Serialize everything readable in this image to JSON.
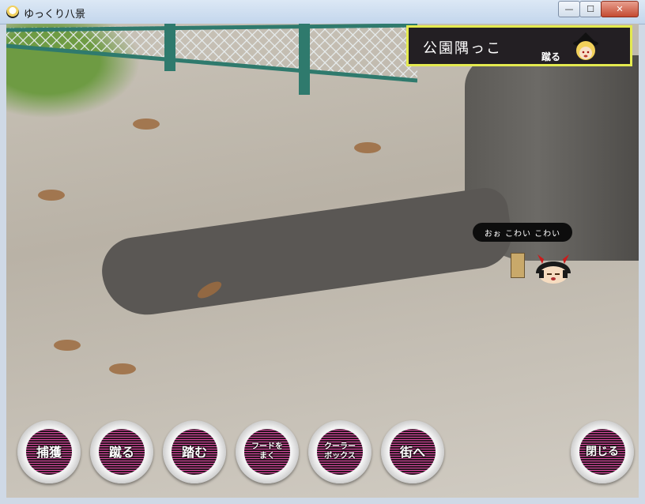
{
  "window": {
    "title": "ゆっくり八景",
    "icon": "yukkuri-app-icon",
    "controls": {
      "minimize": "—",
      "maximize": "☐",
      "close": "✕"
    }
  },
  "location": {
    "name": "公園隅っこ",
    "action": "蹴る",
    "border_color": "#e4ea4f"
  },
  "speech_bubble": {
    "text": "おぉ こわい こわい"
  },
  "actions": [
    {
      "label": "捕獲"
    },
    {
      "label": "蹴る"
    },
    {
      "label": "踏む"
    },
    {
      "label": "フードを\nまく"
    },
    {
      "label": "クーラー\nボックス"
    },
    {
      "label": "街へ"
    },
    {
      "label": "閉じる"
    }
  ]
}
